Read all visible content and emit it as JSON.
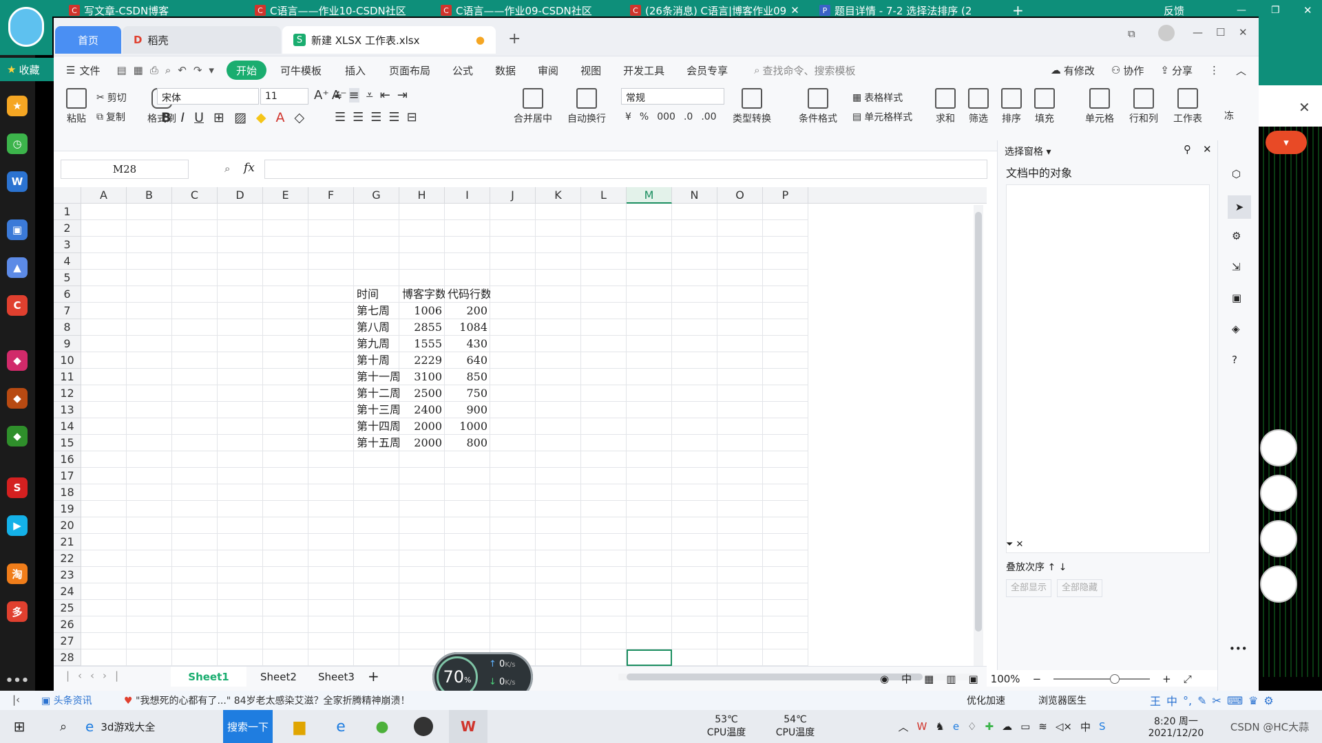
{
  "browser_tabs": [
    {
      "label": "写文章-CSDN博客"
    },
    {
      "label": "C语言——作业10-CSDN社区"
    },
    {
      "label": "C语言——作业09-CSDN社区"
    },
    {
      "label": "(26条消息) C语言|博客作业09"
    },
    {
      "label": "题目详情 - 7-2 选择法排序 (2"
    }
  ],
  "browser_right": {
    "feedback": "反馈"
  },
  "favorites": {
    "label": "收藏"
  },
  "wps": {
    "tabs": {
      "home": "首页",
      "docer": "稻壳",
      "file": "新建 XLSX 工作表.xlsx"
    },
    "menu": [
      "文件",
      "开始",
      "可牛模板",
      "插入",
      "页面布局",
      "公式",
      "数据",
      "审阅",
      "视图",
      "开发工具",
      "会员专享"
    ],
    "search_placeholder": "查找命令、搜索模板",
    "menu_right": {
      "modified": "有修改",
      "collab": "协作",
      "share": "分享"
    },
    "ribbon": {
      "paste": "粘贴",
      "cut": "剪切",
      "copy": "复制",
      "format_painter": "格式刷",
      "font": "宋体",
      "font_size": "11",
      "merge": "合并居中",
      "wrap": "自动换行",
      "number_format": "常规",
      "type_convert": "类型转换",
      "cond_format": "条件格式",
      "table_style": "表格样式",
      "cell_style": "单元格样式",
      "sum": "求和",
      "filter": "筛选",
      "sort": "排序",
      "fill": "填充",
      "cell": "单元格",
      "rowcol": "行和列",
      "worksheet": "工作表",
      "freeze": "冻"
    },
    "name_box": "M28",
    "fx": "fx",
    "columns": [
      "A",
      "B",
      "C",
      "D",
      "E",
      "F",
      "G",
      "H",
      "I",
      "J",
      "K",
      "L",
      "M",
      "N",
      "O",
      "P"
    ],
    "rows": [
      "1",
      "2",
      "3",
      "4",
      "5",
      "6",
      "7",
      "8",
      "9",
      "10",
      "11",
      "12",
      "13",
      "14",
      "15",
      "16",
      "17",
      "18",
      "19",
      "20",
      "21",
      "22",
      "23",
      "24",
      "25",
      "26",
      "27",
      "28"
    ],
    "table": {
      "headers": [
        "时间",
        "博客字数",
        "代码行数"
      ],
      "rows": [
        [
          "第七周",
          "1006",
          "200"
        ],
        [
          "第八周",
          "2855",
          "1084"
        ],
        [
          "第九周",
          "1555",
          "430"
        ],
        [
          "第十周",
          "2229",
          "640"
        ],
        [
          "第十一周",
          "3100",
          "850"
        ],
        [
          "第十二周",
          "2500",
          "750"
        ],
        [
          "第十三周",
          "2400",
          "900"
        ],
        [
          "第十四周",
          "2000",
          "1000"
        ],
        [
          "第十五周",
          "2000",
          "800"
        ]
      ]
    },
    "sheets": [
      "Sheet1",
      "Sheet2",
      "Sheet3"
    ],
    "zoom": "100%",
    "side_pane": {
      "title": "选择窗格",
      "subtitle": "文档中的对象",
      "order": "叠放次序",
      "show_all": "全部显示",
      "hide_all": "全部隐藏"
    }
  },
  "speed_widget": {
    "percent": "70",
    "unit": "%",
    "up": "0",
    "down": "0",
    "rate": "K/s"
  },
  "news": {
    "source": "头条资讯",
    "headline": "\"我想死的心都有了...\" 84岁老太感染艾滋？全家折腾精神崩溃！",
    "optimize": "优化加速",
    "browser_doctor": "浏览器医生"
  },
  "taskbar": {
    "search_text": "3d游戏大全",
    "search_btn": "搜索一下",
    "cpu1_temp": "53℃",
    "cpu1_label": "CPU温度",
    "cpu2_temp": "54℃",
    "cpu2_label": "CPU温度",
    "time": "8:20 周一",
    "date": "2021/12/20",
    "watermark": "CSDN @HC大蒜"
  },
  "colors": {
    "accent": "#1aad6f",
    "teal": "#0e8f7a",
    "selection": "#1a8e5f"
  }
}
